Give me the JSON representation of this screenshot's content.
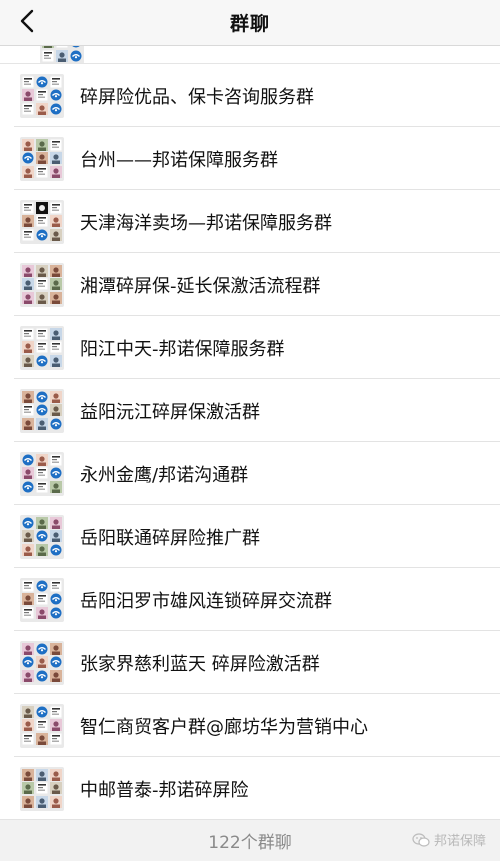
{
  "nav": {
    "title": "群聊",
    "back_icon": "chevron-left-icon"
  },
  "groups": [
    {
      "name": "碎屏险优品、保卡咨询服务群",
      "avatar": "ldw"
    },
    {
      "name": "台州——邦诺保障服务群",
      "avatar": "pdw"
    },
    {
      "name": "天津海洋卖场—邦诺保障服务群",
      "avatar": "dwd"
    },
    {
      "name": "湘潭碎屏保-延长保激活流程群",
      "avatar": "pdp"
    },
    {
      "name": "阳江中天-邦诺保障服务群",
      "avatar": "wdl"
    },
    {
      "name": "益阳沅江碎屏保激活群",
      "avatar": "plb"
    },
    {
      "name": "永州金鹰/邦诺沟通群",
      "avatar": "lbw"
    },
    {
      "name": "岳阳联通碎屏险推广群",
      "avatar": "bpl"
    },
    {
      "name": "岳阳汨罗市雄风连锁碎屏交流群",
      "avatar": "ldw"
    },
    {
      "name": "张家界慈利蓝天  碎屏险激活群",
      "avatar": "pbb"
    },
    {
      "name": "智仁商贸客户群@廊坊华为营销中心",
      "avatar": "dpl"
    },
    {
      "name": "中邮普泰-邦诺碎屏险",
      "avatar": "pdp"
    }
  ],
  "footer": {
    "count_text": "122个群聊",
    "watermark": "邦诺保障",
    "watermark_icon": "wechat-icon"
  },
  "colors": {
    "nav_bg": "#f7f7f7",
    "footer_bg": "#f2f2f2",
    "footer_text": "#8a8a8a",
    "divider": "#e3e3e3",
    "blue_logo": "#1e6fc4"
  }
}
